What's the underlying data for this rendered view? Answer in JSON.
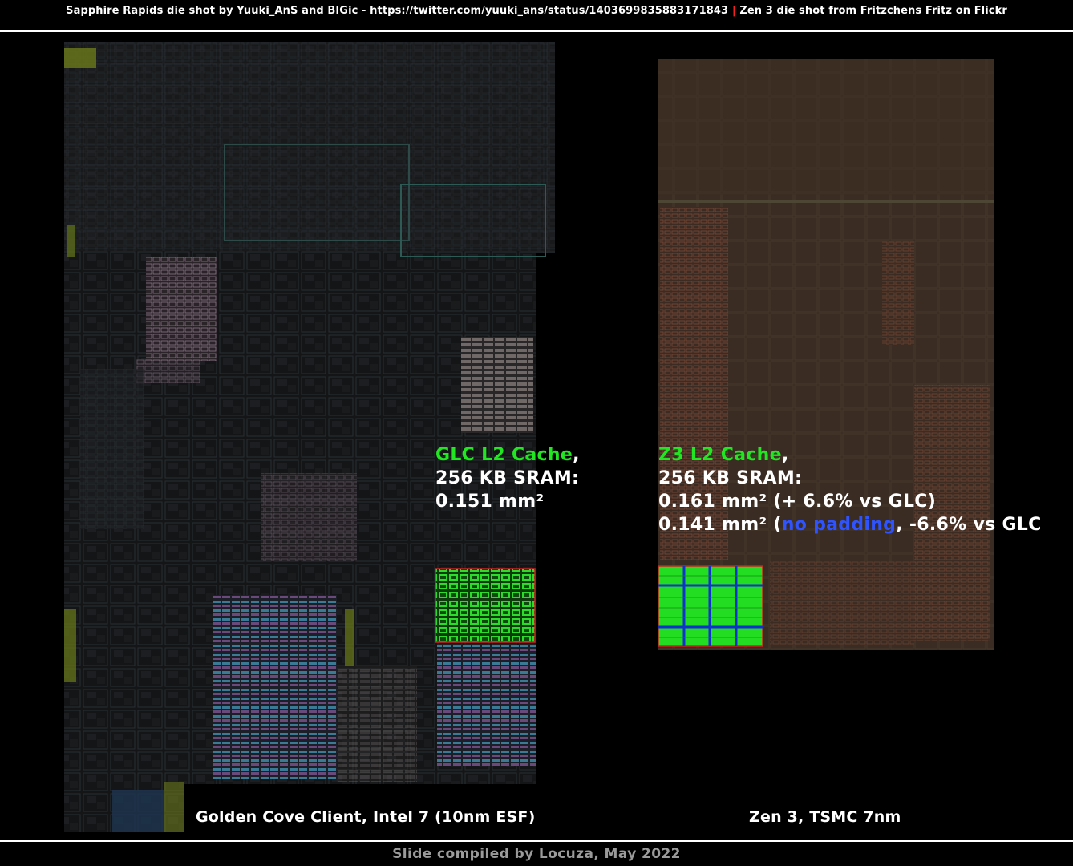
{
  "credits": {
    "left": "Sapphire Rapids die shot by Yuuki_AnS and BIGic - https://twitter.com/yuuki_ans/status/1403699835883171843",
    "separator": "|",
    "right": "Zen 3 die shot from Fritzchens Fritz on Flickr"
  },
  "glc": {
    "name": "GLC L2 Cache",
    "comma": ",",
    "line2": "256 KB SRAM:",
    "line3": "0.151 mm²",
    "caption": "Golden Cove Client, Intel 7 (10nm ESF)"
  },
  "z3": {
    "name": "Z3 L2 Cache",
    "comma": ",",
    "line2": "256 KB SRAM:",
    "line3": "0.161 mm² (+ 6.6% vs GLC)",
    "line4_pre": "0.141 mm² (",
    "line4_highlight": "no padding",
    "line4_post": ", -6.6% vs GLC",
    "caption": "Zen 3, TSMC 7nm"
  },
  "footer": "Slide compiled by Locuza, May 2022",
  "colors": {
    "highlight_green": "#22e622",
    "highlight_blue": "#2f54ff",
    "separator_red": "#ff2020",
    "intel_die_base": "#17181a",
    "zen_die_base": "#3a2b21"
  }
}
